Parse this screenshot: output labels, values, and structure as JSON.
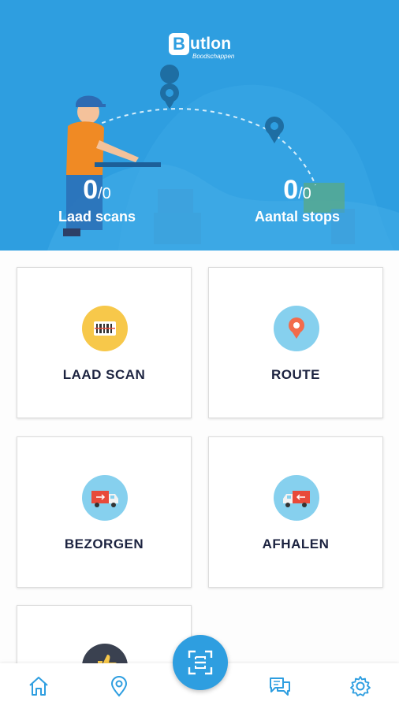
{
  "brand": {
    "name_initial": "B",
    "name_rest": "utlon",
    "tagline": "Boodschappen"
  },
  "stats": [
    {
      "value": "0",
      "total": "/0",
      "label": "Laad scans"
    },
    {
      "value": "0",
      "total": "/0",
      "label": "Aantal stops"
    }
  ],
  "tiles": [
    {
      "label": "LAAD SCAN",
      "icon": "barcode-icon",
      "color": "#f7c84a"
    },
    {
      "label": "ROUTE",
      "icon": "map-pin-icon",
      "color": "#86d0ee"
    },
    {
      "label": "BEZORGEN",
      "icon": "delivery-truck-icon",
      "color": "#86d0ee"
    },
    {
      "label": "AFHALEN",
      "icon": "pickup-truck-icon",
      "color": "#86d0ee"
    },
    {
      "label": "",
      "icon": "thumbs-up-icon",
      "color": "#3a4150"
    }
  ],
  "nav": {
    "items": [
      "home-icon",
      "location-icon",
      "scan-icon",
      "chat-icon",
      "settings-icon"
    ]
  },
  "colors": {
    "primary": "#2e9ee0",
    "text_dark": "#1c2340",
    "card_border": "#dcdcdc"
  }
}
